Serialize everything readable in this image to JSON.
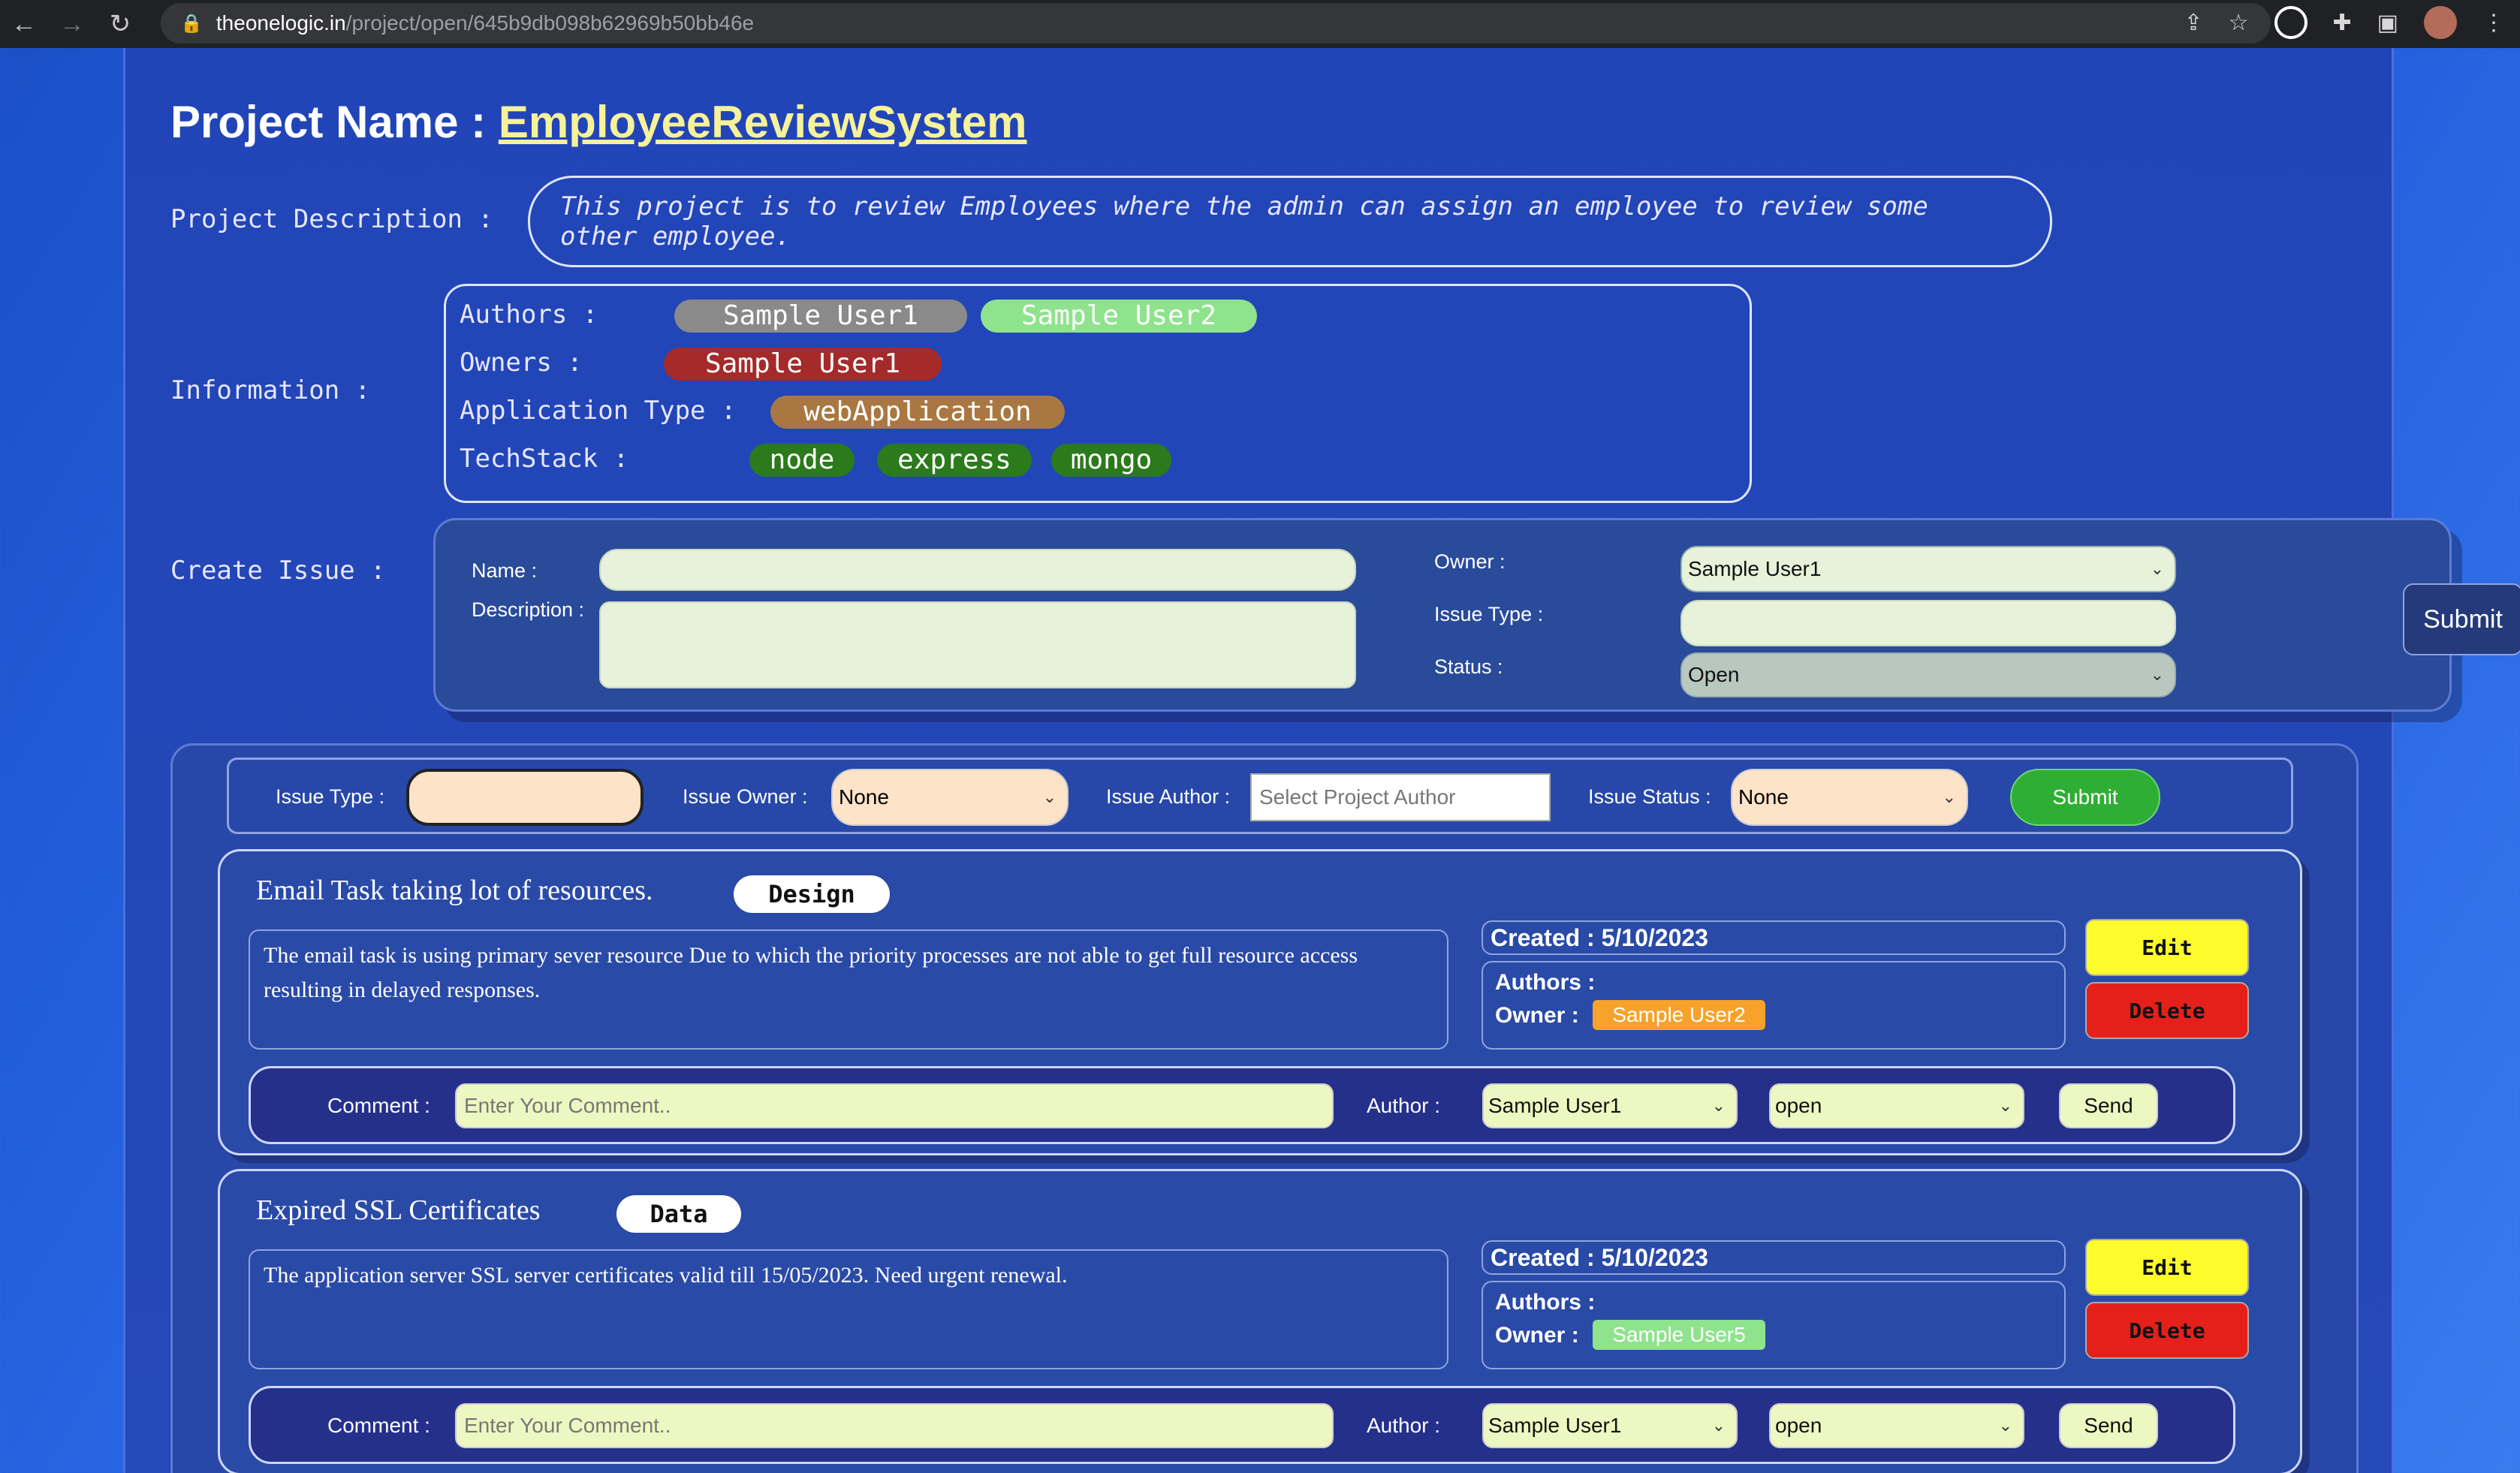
{
  "browser": {
    "url_host": "theonelogic.in",
    "url_path": "/project/open/645b9db098b62969b50bb46e"
  },
  "project": {
    "name_label": "Project Name :",
    "name": "EmployeeReviewSystem",
    "description_label": "Project Description :",
    "description": "This project is to review Employees where the admin can assign an employee to review some other employee.",
    "information_label": "Information :",
    "authors_label": "Authors :",
    "authors": [
      "Sample User1",
      "Sample User2"
    ],
    "owners_label": "Owners :",
    "owners": [
      "Sample User1"
    ],
    "app_type_label": "Application Type :",
    "app_type": "webApplication",
    "techstack_label": "TechStack :",
    "techstack": [
      "node",
      "express",
      "mongo"
    ]
  },
  "create_issue": {
    "section_label": "Create Issue :",
    "name_label": "Name :",
    "description_label": "Description :",
    "owner_label": "Owner :",
    "owner_value": "Sample User1",
    "issue_type_label": "Issue Type :",
    "status_label": "Status :",
    "status_value": "Open",
    "submit_label": "Submit"
  },
  "filters": {
    "issue_type_label": "Issue Type :",
    "issue_owner_label": "Issue Owner :",
    "issue_owner_value": "None",
    "issue_author_label": "Issue Author :",
    "issue_author_placeholder": "Select Project Author",
    "issue_status_label": "Issue Status :",
    "issue_status_value": "None",
    "submit_label": "Submit"
  },
  "issues": [
    {
      "title": "Email Task taking lot of resources.",
      "tag": "Design",
      "description": "The email task is using primary sever resource Due to which the priority processes are not able to get full resource access resulting in delayed responses.",
      "created": "Created : 5/10/2023",
      "authors_label": "Authors :",
      "owner_label": "Owner :",
      "owner": "Sample User2",
      "edit_label": "Edit",
      "delete_label": "Delete",
      "comment_label": "Comment :",
      "comment_placeholder": "Enter Your Comment..",
      "author_label": "Author :",
      "author_value": "Sample User1",
      "status_value": "open",
      "send_label": "Send"
    },
    {
      "title": "Expired SSL Certificates",
      "tag": "Data",
      "description": "The application server SSL server certificates valid till 15/05/2023. Need urgent renewal.",
      "created": "Created : 5/10/2023",
      "authors_label": "Authors :",
      "owner_label": "Owner :",
      "owner": "Sample User5",
      "edit_label": "Edit",
      "delete_label": "Delete",
      "comment_label": "Comment :",
      "comment_placeholder": "Enter Your Comment..",
      "author_label": "Author :",
      "author_value": "Sample User1",
      "status_value": "open",
      "send_label": "Send"
    }
  ],
  "colors": {
    "author_pill_1": "#8a8a8a",
    "author_pill_2": "#8fe38d",
    "owner_pill": "#a52a2a",
    "app_type_pill": "#a97842",
    "tech_pill": "#2b7a1c",
    "owner_badge_1": "#f7a22a",
    "owner_badge_2": "#8fe38d"
  }
}
